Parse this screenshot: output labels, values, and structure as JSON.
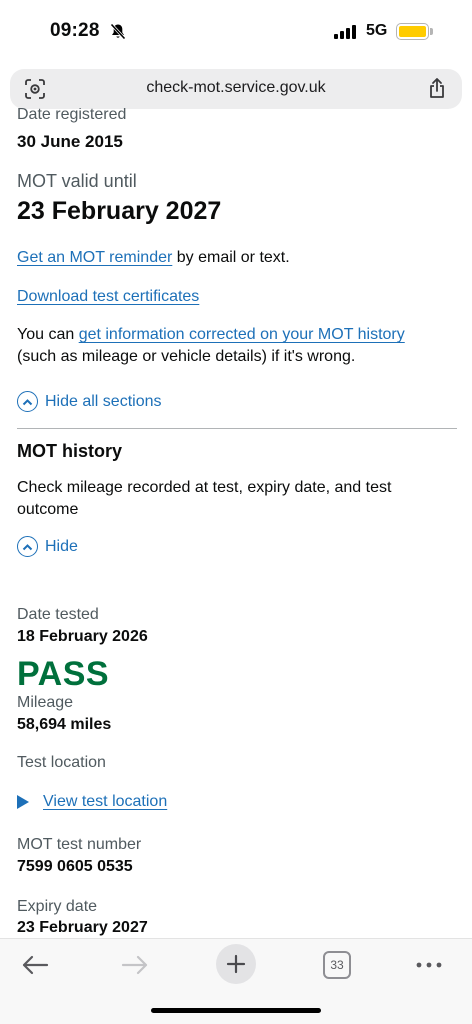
{
  "status": {
    "time": "09:28",
    "network": "5G"
  },
  "browser": {
    "url": "check-mot.service.gov.uk",
    "tab_count": "33"
  },
  "vehicle": {
    "date_registered_label": "Date registered",
    "date_registered": "30 June 2015",
    "mot_valid_label": "MOT valid until",
    "mot_valid_until": "23 February 2027"
  },
  "links": {
    "reminder": "Get an MOT reminder",
    "reminder_suffix": " by email or text.",
    "download": "Download test certificates",
    "correct_prefix": "You can ",
    "correct_link": "get information corrected on your MOT history",
    "correct_suffix": "(such as mileage or vehicle details) if it's wrong.",
    "hide_all": "Hide all sections"
  },
  "history": {
    "heading": "MOT history",
    "description": "Check mileage recorded at test, expiry date, and test outcome",
    "hide": "Hide",
    "date_tested_label": "Date tested",
    "date_tested": "18 February 2026",
    "result": "PASS",
    "mileage_label": "Mileage",
    "mileage": "58,694 miles",
    "location_label": "Test location",
    "view_location": "View test location",
    "test_number_label": "MOT test number",
    "test_number": "7599 0605 0535",
    "expiry_label": "Expiry date",
    "expiry": "23 February 2027"
  },
  "colors": {
    "link": "#1d70b8",
    "pass": "#00703c",
    "text": "#0b0c0c",
    "secondary": "#505a5f"
  }
}
